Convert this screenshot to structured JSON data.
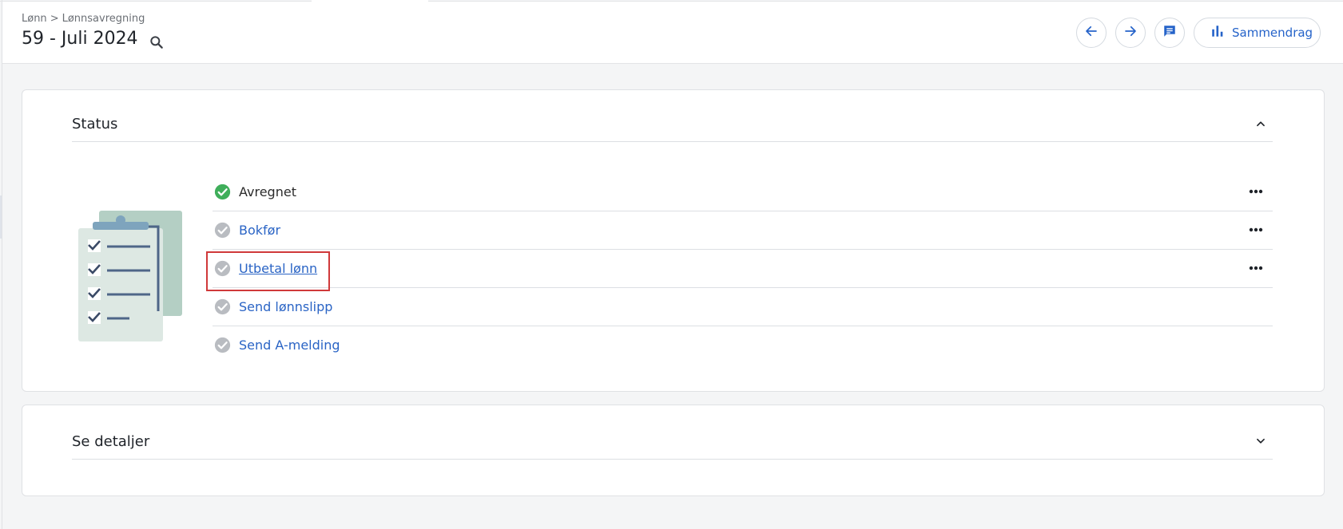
{
  "breadcrumb": {
    "root": "Lønn",
    "separator": ">",
    "current": "Lønnsavregning"
  },
  "header": {
    "title": "59 - Juli 2024",
    "search_icon": "search-icon",
    "actions": {
      "prev_icon": "arrow-left-icon",
      "next_icon": "arrow-right-icon",
      "comment_icon": "chat-icon",
      "summary_icon": "bar-chart-icon",
      "summary_label": "Sammendrag"
    }
  },
  "status_section": {
    "title": "Status",
    "expanded": true,
    "illustration": "clipboard-checklist-icon",
    "items": [
      {
        "label": "Avregnet",
        "state": "done",
        "has_menu": true
      },
      {
        "label": "Bokfør",
        "state": "pending",
        "has_menu": true
      },
      {
        "label": "Utbetal lønn",
        "state": "pending",
        "has_menu": true,
        "highlighted": true
      },
      {
        "label": "Send lønnslipp",
        "state": "pending",
        "has_menu": false
      },
      {
        "label": "Send A-melding",
        "state": "pending",
        "has_menu": false
      }
    ]
  },
  "details_section": {
    "title": "Se detaljer",
    "expanded": false
  },
  "colors": {
    "accent": "#2563c9",
    "done_green": "#3fae5a",
    "pending_grey": "#b9bcc1",
    "highlight_red": "#d0393a"
  }
}
